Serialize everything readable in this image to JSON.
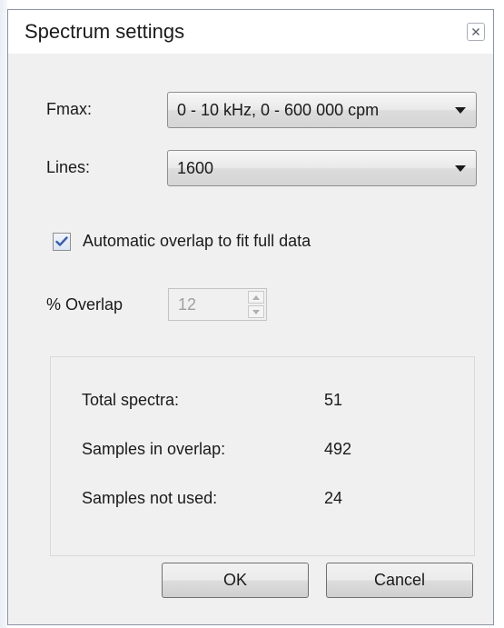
{
  "window": {
    "title": "Spectrum settings",
    "close_icon": "close-icon"
  },
  "fmax": {
    "label": "Fmax:",
    "selected": "0 - 10 kHz, 0 - 600 000 cpm"
  },
  "lines": {
    "label": "Lines:",
    "selected": "1600"
  },
  "auto_overlap": {
    "label": "Automatic overlap to fit full data",
    "checked": true
  },
  "overlap": {
    "label": "% Overlap",
    "value": "12",
    "enabled": false
  },
  "stats": [
    {
      "label": "Total spectra:",
      "value": "51"
    },
    {
      "label": "Samples in overlap:",
      "value": "492"
    },
    {
      "label": "Samples not used:",
      "value": "24"
    }
  ],
  "buttons": {
    "ok": "OK",
    "cancel": "Cancel"
  },
  "colors": {
    "accent": "#3a5fa8",
    "disabled_text": "#a0a0a0",
    "window_bg": "#f0f0f0"
  }
}
